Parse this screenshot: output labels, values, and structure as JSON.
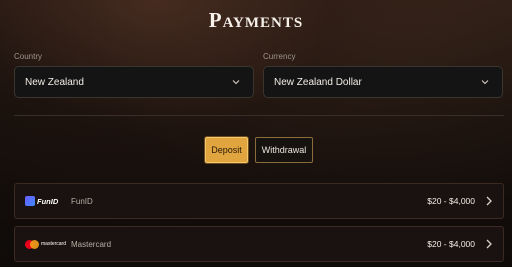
{
  "page": {
    "title": "Payments"
  },
  "country": {
    "label": "Country",
    "value": "New Zealand"
  },
  "currency": {
    "label": "Currency",
    "value": "New Zealand Dollar"
  },
  "tabs": {
    "deposit": "Deposit",
    "withdrawal": "Withdrawal"
  },
  "methods": [
    {
      "logo_text": "FunID",
      "name": "FunID",
      "range": "$20 - $4,000",
      "icon": "funid-logo"
    },
    {
      "logo_text": "mastercard",
      "name": "Mastercard",
      "range": "$20 - $4,000",
      "icon": "mastercard-logo"
    }
  ],
  "colors": {
    "accent": "#e0a53f",
    "background": "#140e0a"
  }
}
